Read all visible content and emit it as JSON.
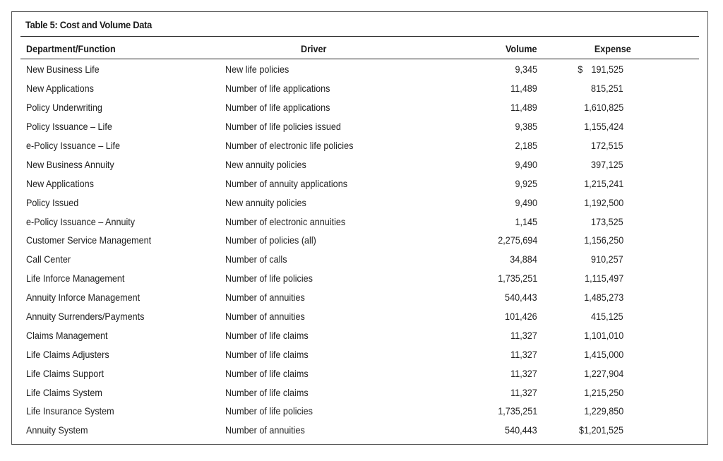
{
  "title": "Table 5: Cost and Volume Data",
  "columns": {
    "department": "Department/Function",
    "driver": "Driver",
    "volume": "Volume",
    "expense": "Expense"
  },
  "first_row_currency_symbol": "$",
  "rows": [
    {
      "department": "New Business Life",
      "driver": "New life policies",
      "volume": "9,345",
      "expense": "191,525"
    },
    {
      "department": "New Applications",
      "driver": "Number of life applications",
      "volume": "11,489",
      "expense": "815,251"
    },
    {
      "department": "Policy Underwriting",
      "driver": "Number of life applications",
      "volume": "11,489",
      "expense": "1,610,825"
    },
    {
      "department": "Policy Issuance – Life",
      "driver": "Number of life policies issued",
      "volume": "9,385",
      "expense": "1,155,424"
    },
    {
      "department": "e-Policy Issuance – Life",
      "driver": "Number of electronic life policies",
      "volume": "2,185",
      "expense": "172,515"
    },
    {
      "department": "New Business Annuity",
      "driver": "New annuity policies",
      "volume": "9,490",
      "expense": "397,125"
    },
    {
      "department": "New Applications",
      "driver": "Number of annuity applications",
      "volume": "9,925",
      "expense": "1,215,241"
    },
    {
      "department": "Policy Issued",
      "driver": "New annuity policies",
      "volume": "9,490",
      "expense": "1,192,500"
    },
    {
      "department": "e-Policy Issuance – Annuity",
      "driver": "Number of electronic annuities",
      "volume": "1,145",
      "expense": "173,525"
    },
    {
      "department": "Customer Service Management",
      "driver": "Number of policies (all)",
      "volume": "2,275,694",
      "expense": "1,156,250"
    },
    {
      "department": "Call Center",
      "driver": "Number of calls",
      "volume": "34,884",
      "expense": "910,257"
    },
    {
      "department": "Life Inforce Management",
      "driver": "Number of life policies",
      "volume": "1,735,251",
      "expense": "1,115,497"
    },
    {
      "department": "Annuity Inforce Management",
      "driver": "Number of annuities",
      "volume": "540,443",
      "expense": "1,485,273"
    },
    {
      "department": "Annuity Surrenders/Payments",
      "driver": "Number of annuities",
      "volume": "101,426",
      "expense": "415,125"
    },
    {
      "department": "Claims Management",
      "driver": "Number of life claims",
      "volume": "11,327",
      "expense": "1,101,010"
    },
    {
      "department": "Life Claims Adjusters",
      "driver": "Number of life claims",
      "volume": "11,327",
      "expense": "1,415,000"
    },
    {
      "department": "Life Claims Support",
      "driver": "Number of life claims",
      "volume": "11,327",
      "expense": "1,227,904"
    },
    {
      "department": "Life Claims System",
      "driver": "Number of life claims",
      "volume": "11,327",
      "expense": "1,215,250"
    },
    {
      "department": "Life Insurance System",
      "driver": "Number of life policies",
      "volume": "1,735,251",
      "expense": "1,229,850"
    },
    {
      "department": "Annuity System",
      "driver": "Number of annuities",
      "volume": "540,443",
      "expense": "$1,201,525"
    }
  ]
}
